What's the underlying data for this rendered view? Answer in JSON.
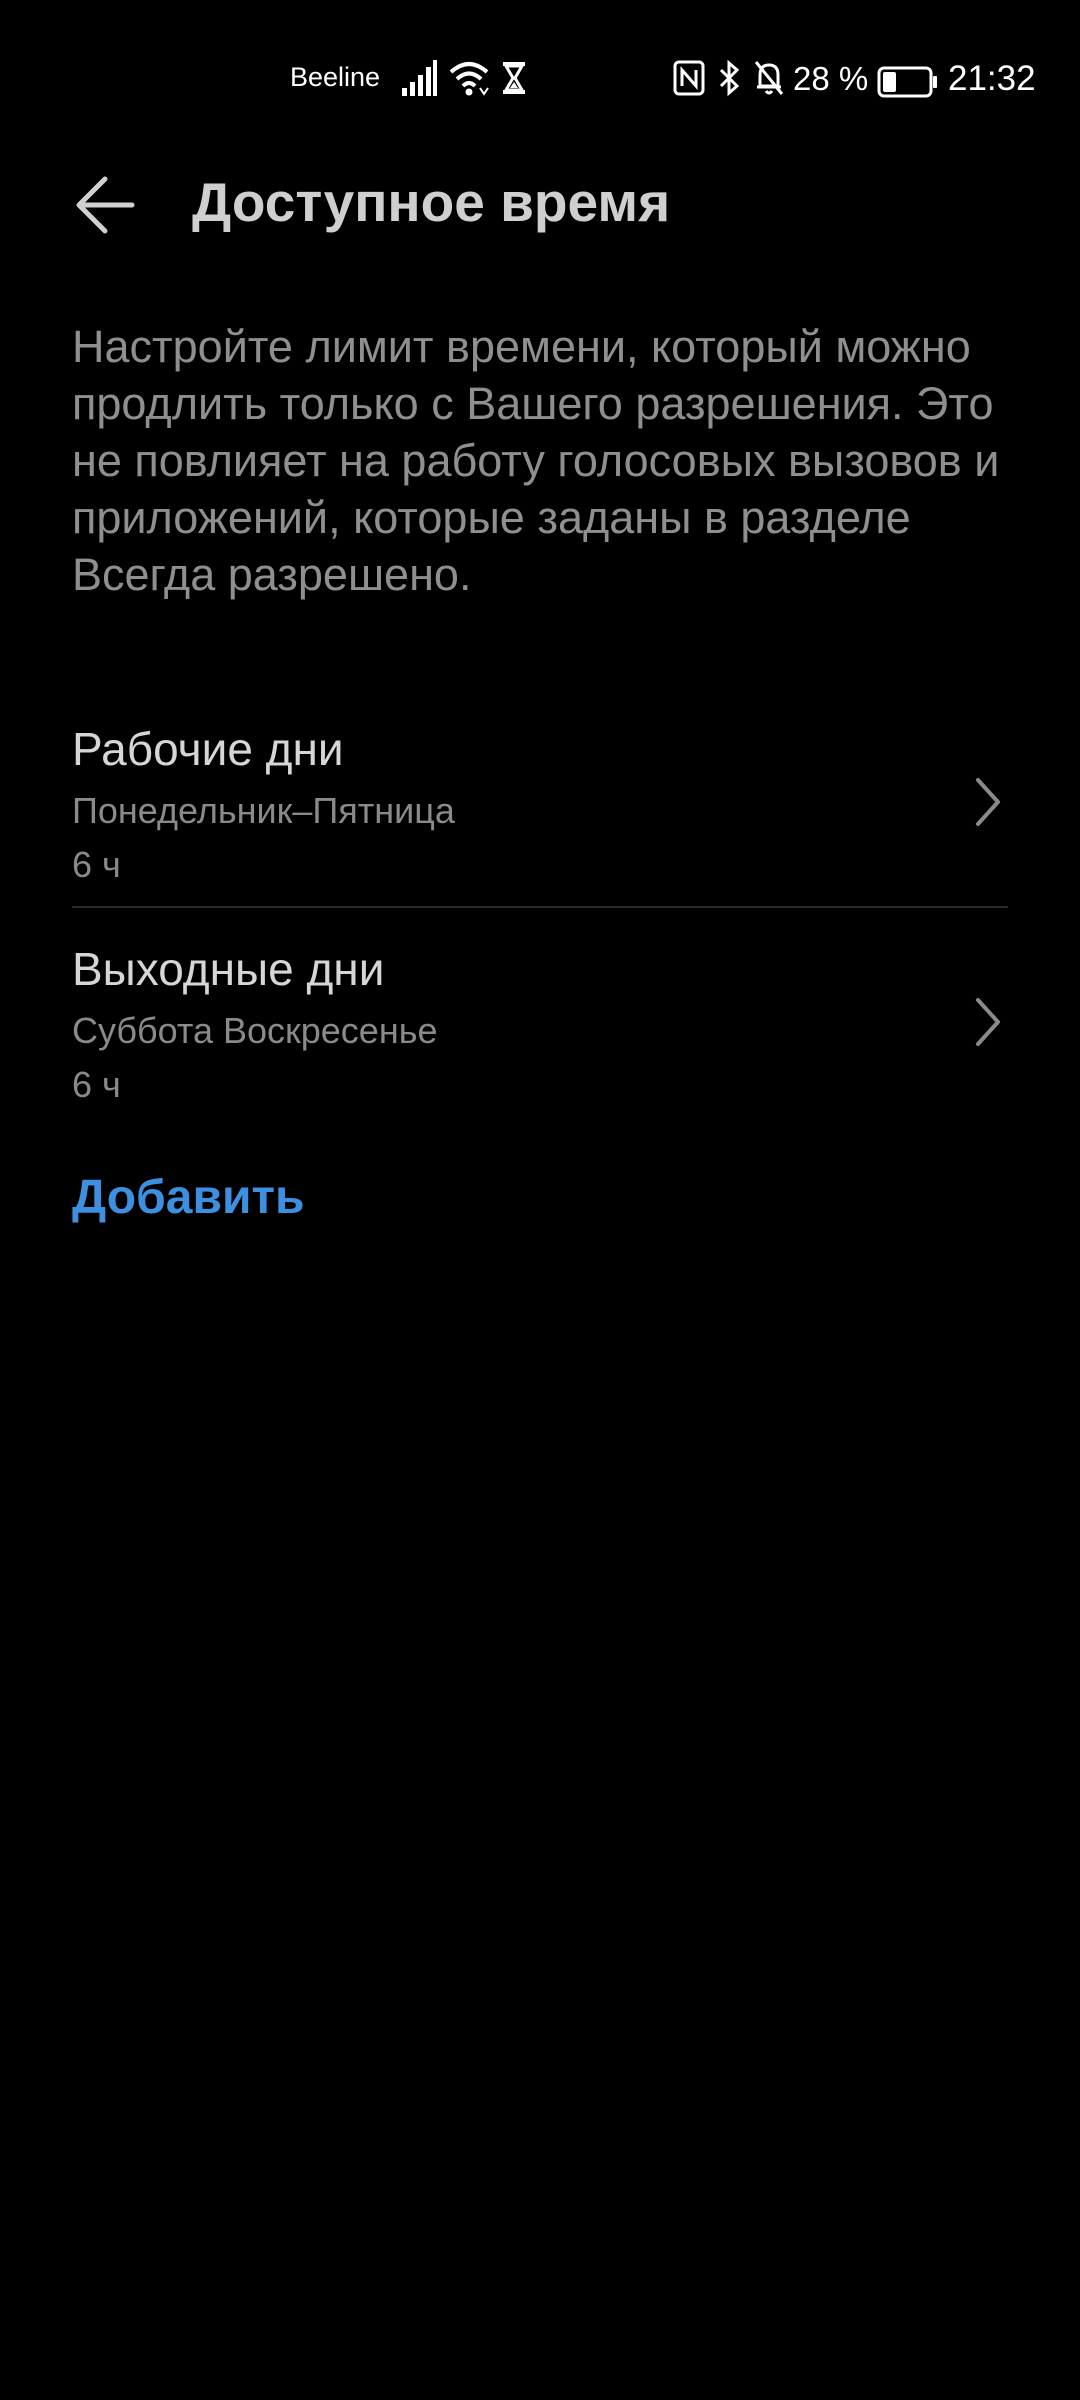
{
  "status_bar": {
    "carrier": "Beeline",
    "battery_percent": "28 %",
    "time": "21:32",
    "icons": [
      "signal-icon",
      "wifi-icon",
      "hourglass-icon",
      "nfc-icon",
      "bluetooth-icon",
      "bell-off-icon",
      "battery-icon"
    ]
  },
  "header": {
    "back_icon": "arrow-left-icon",
    "title": "Доступное время"
  },
  "description": "Настройте лимит времени, который можно продлить только с Вашего разрешения. Это не повлияет на работу голосовых вызовов и приложений, которые заданы в разделе Всегда разрешено.",
  "schedules": [
    {
      "title": "Рабочие дни",
      "days": "Понедельник–Пятница",
      "limit": "6 ч"
    },
    {
      "title": "Выходные дни",
      "days": "Суббота Воскресенье",
      "limit": "6 ч"
    }
  ],
  "add_label": "Добавить",
  "colors": {
    "background": "#000000",
    "accent": "#3d8fe0",
    "title_text": "#cfcfcf",
    "secondary_text": "#8a8a8a"
  }
}
